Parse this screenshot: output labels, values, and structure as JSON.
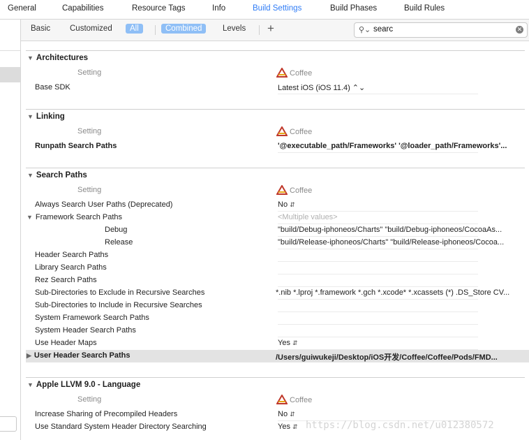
{
  "top_tabs": [
    "General",
    "Capabilities",
    "Resource Tags",
    "Info",
    "Build Settings",
    "Build Phases",
    "Build Rules"
  ],
  "active_top_tab": "Build Settings",
  "filter": {
    "basic": "Basic",
    "customized": "Customized",
    "all": "All",
    "combined": "Combined",
    "levels": "Levels",
    "add": "+",
    "search_value": "searc"
  },
  "target_name": "Coffee",
  "setting_header": "Setting",
  "sections": {
    "architectures": {
      "title": "Architectures",
      "rows": [
        {
          "label": "Base SDK",
          "value": "Latest iOS (iOS 11.4) ⌃⌄"
        }
      ]
    },
    "linking": {
      "title": "Linking",
      "rows": [
        {
          "label": "Runpath Search Paths",
          "value": "'@executable_path/Frameworks' '@loader_path/Frameworks'..."
        }
      ]
    },
    "search_paths": {
      "title": "Search Paths",
      "rows": [
        {
          "label": "Always Search User Paths (Deprecated)",
          "value": "No"
        },
        {
          "label": "Framework Search Paths",
          "value": "<Multiple values>"
        },
        {
          "label": "Debug",
          "value": "\"build/Debug-iphoneos/Charts\" \"build/Debug-iphoneos/CocoaAs..."
        },
        {
          "label": "Release",
          "value": "\"build/Release-iphoneos/Charts\" \"build/Release-iphoneos/Cocoa..."
        },
        {
          "label": "Header Search Paths",
          "value": ""
        },
        {
          "label": "Library Search Paths",
          "value": ""
        },
        {
          "label": "Rez Search Paths",
          "value": ""
        },
        {
          "label": "Sub-Directories to Exclude in Recursive Searches",
          "value": "*.nib *.lproj *.framework *.gch *.xcode* *.xcassets (*) .DS_Store CV..."
        },
        {
          "label": "Sub-Directories to Include in Recursive Searches",
          "value": ""
        },
        {
          "label": "System Framework Search Paths",
          "value": ""
        },
        {
          "label": "System Header Search Paths",
          "value": ""
        },
        {
          "label": "Use Header Maps",
          "value": "Yes"
        },
        {
          "label": "User Header Search Paths",
          "value": "/Users/guiwukeji/Desktop/iOS开发/Coffee/Coffee/Pods/FMD..."
        }
      ]
    },
    "llvm_language": {
      "title": "Apple LLVM 9.0 - Language",
      "rows": [
        {
          "label": "Increase Sharing of Precompiled Headers",
          "value": "No"
        },
        {
          "label": "Use Standard System Header Directory Searching",
          "value": "Yes"
        }
      ]
    }
  },
  "watermark": "https://blog.csdn.net/u012380572"
}
